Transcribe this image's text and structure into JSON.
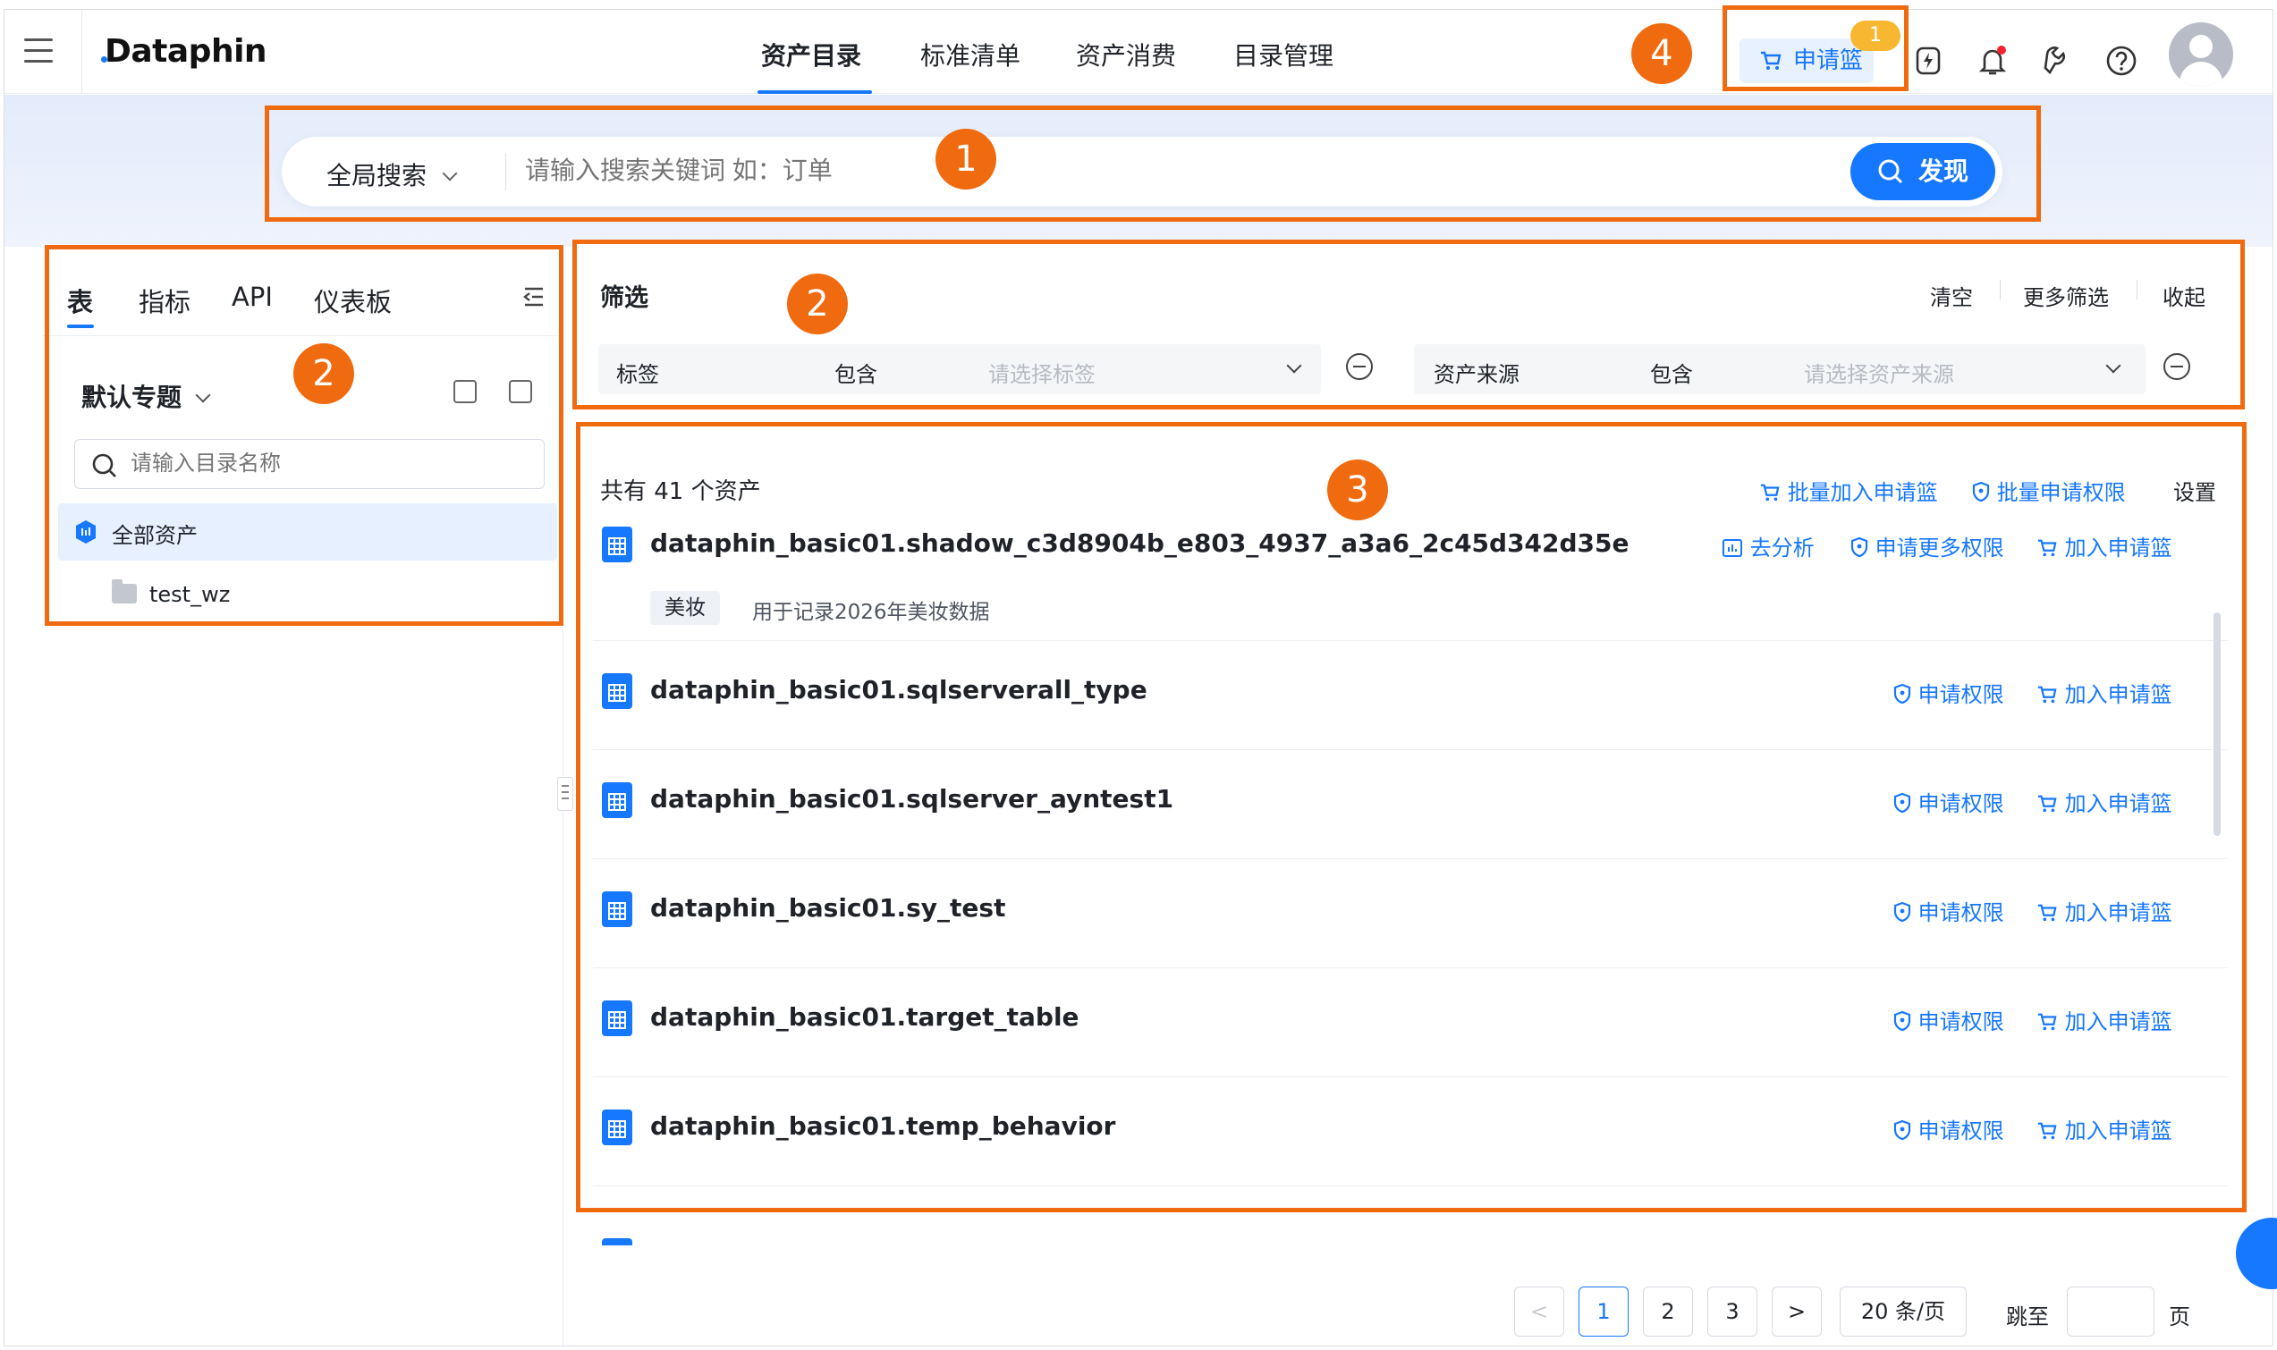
{
  "header": {
    "logo": "Dataphin",
    "nav": [
      "资产目录",
      "标准清单",
      "资产消费",
      "目录管理"
    ],
    "cart_label": "申请篮",
    "cart_count": "1"
  },
  "search": {
    "scope": "全局搜索",
    "placeholder": "请输入搜索关键词 如：订单",
    "button": "发现"
  },
  "left": {
    "tabs": [
      "表",
      "指标",
      "API",
      "仪表板"
    ],
    "topic": "默认专题",
    "dir_placeholder": "请输入目录名称",
    "tree": [
      {
        "label": "全部资产"
      },
      {
        "label": "test_wz"
      }
    ]
  },
  "filter": {
    "title": "筛选",
    "links": [
      "清空",
      "更多筛选",
      "收起"
    ],
    "conditions": [
      {
        "field": "标签",
        "op": "包含",
        "placeholder": "请选择标签"
      },
      {
        "field": "资产来源",
        "op": "包含",
        "placeholder": "请选择资产来源"
      }
    ]
  },
  "list": {
    "total": "共有 41 个资产",
    "actions": [
      "批量加入申请篮",
      "批量申请权限",
      "设置"
    ],
    "rows": [
      {
        "name": "dataphin_basic01.shadow_c3d8904b_e803_4937_a3a6_2c45d342d35e",
        "act1": "去分析",
        "act2": "申请更多权限",
        "act3": "加入申请篮",
        "tag": "美妆",
        "desc": "用于记录2026年美妆数据"
      },
      {
        "name": "dataphin_basic01.sqlserverall_type",
        "act2": "申请权限",
        "act3": "加入申请篮"
      },
      {
        "name": "dataphin_basic01.sqlserver_ayntest1",
        "act2": "申请权限",
        "act3": "加入申请篮"
      },
      {
        "name": "dataphin_basic01.sy_test",
        "act2": "申请权限",
        "act3": "加入申请篮"
      },
      {
        "name": "dataphin_basic01.target_table",
        "act2": "申请权限",
        "act3": "加入申请篮"
      },
      {
        "name": "dataphin_basic01.temp_behavior",
        "act2": "申请权限",
        "act3": "加入申请篮"
      }
    ]
  },
  "pagination": {
    "pages": [
      "1",
      "2",
      "3"
    ],
    "current_page": "1",
    "page_size": "20 条/页",
    "jump_label": "跳至",
    "page_suffix": "页"
  },
  "annotations": [
    "1",
    "2",
    "2",
    "3",
    "4"
  ],
  "colors": {
    "accent": "#1677ff",
    "annotation": "#f06a0f",
    "badge": "#f7b731"
  }
}
